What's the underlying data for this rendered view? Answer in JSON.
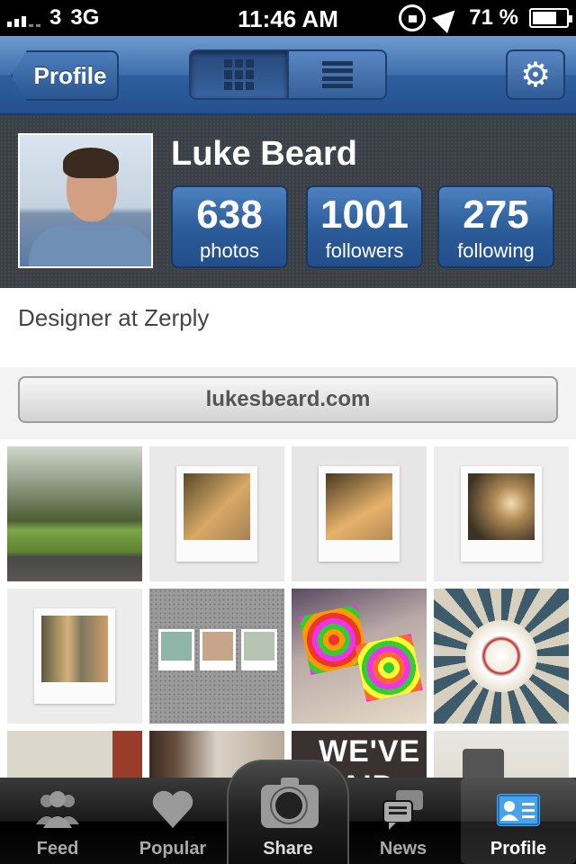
{
  "status_bar": {
    "carrier": "3",
    "network": "3G",
    "time": "11:46 AM",
    "battery": "71 %",
    "battery_level": 0.71
  },
  "nav": {
    "back_label": "Profile",
    "view_modes": [
      "grid-icon",
      "list-icon"
    ],
    "active_view": "grid",
    "settings_icon": "gear-icon"
  },
  "profile": {
    "name": "Luke Beard",
    "stats": [
      {
        "value": "638",
        "label": "photos"
      },
      {
        "value": "1001",
        "label": "followers"
      },
      {
        "value": "275",
        "label": "following"
      }
    ],
    "bio": "Designer at Zerply",
    "website": "lukesbeard.com"
  },
  "photos": [
    {
      "subject": "park-trees"
    },
    {
      "subject": "polaroid-sunlit-room"
    },
    {
      "subject": "polaroid-sunlit-floor"
    },
    {
      "subject": "polaroid-lamp"
    },
    {
      "subject": "polaroid-window-light"
    },
    {
      "subject": "three-polaroids-on-wall"
    },
    {
      "subject": "colorful-album-covers"
    },
    {
      "subject": "dome-ceiling"
    },
    {
      "subject": "graffiti-wall"
    },
    {
      "subject": "window-frame"
    },
    {
      "subject": "wall-sign",
      "text": "WE'VE SAID IT"
    },
    {
      "subject": "camera-object"
    }
  ],
  "tabs": [
    {
      "label": "Feed",
      "icon": "people-icon"
    },
    {
      "label": "Popular",
      "icon": "heart-icon"
    },
    {
      "label": "Share",
      "icon": "camera-icon"
    },
    {
      "label": "News",
      "icon": "speech-bubbles-icon"
    },
    {
      "label": "Profile",
      "icon": "profile-card-icon",
      "selected": true
    }
  ]
}
